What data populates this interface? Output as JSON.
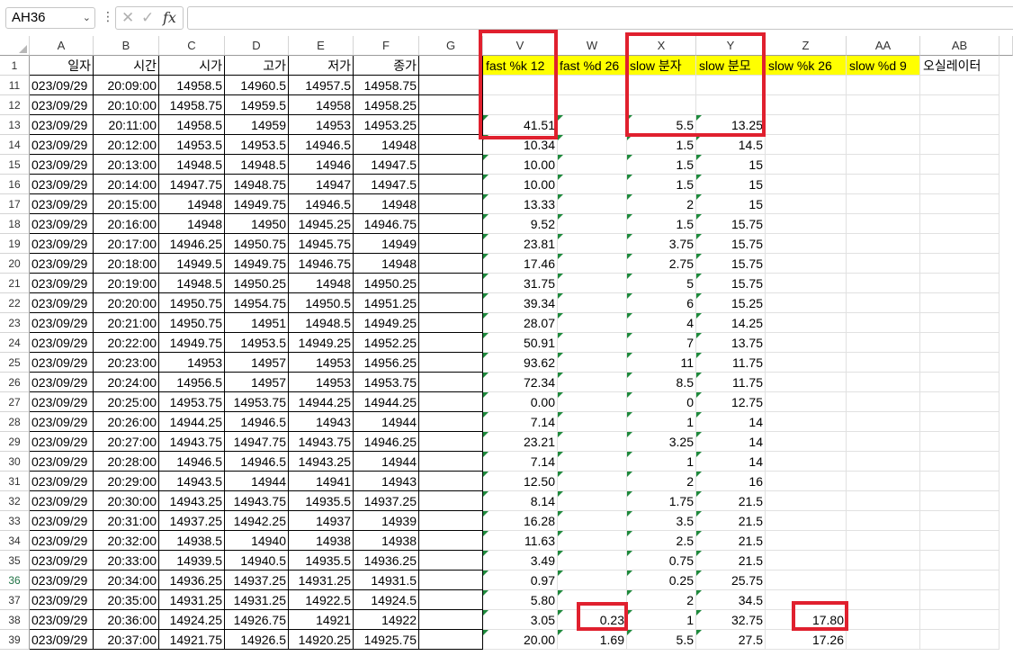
{
  "formula_bar": {
    "name_box": "AH36",
    "formula": ""
  },
  "icons": {
    "cancel": "x-icon",
    "enter": "check-icon",
    "function": "fx-icon"
  },
  "columns": [
    "A",
    "B",
    "C",
    "D",
    "E",
    "F",
    "G",
    "V",
    "W",
    "X",
    "Y",
    "Z",
    "AA",
    "AB"
  ],
  "header_row": {
    "row": "1",
    "A": "일자",
    "B": "시간",
    "C": "시가",
    "D": "고가",
    "E": "저가",
    "F": "종가",
    "G": "",
    "V": "fast %k 12",
    "W": "fast %d 26",
    "X": "slow 분자",
    "Y": "slow 분모",
    "Z": "slow %k 26",
    "AA": "slow %d 9",
    "AB": "오실레이터"
  },
  "rows": [
    {
      "row": "11",
      "A": "023/09/29",
      "B": "20:09:00",
      "C": "14958.5",
      "D": "14960.5",
      "E": "14957.5",
      "F": "14958.75",
      "V": "",
      "W": "",
      "X": "",
      "Y": "",
      "Z": ""
    },
    {
      "row": "12",
      "A": "023/09/29",
      "B": "20:10:00",
      "C": "14958.75",
      "D": "14959.5",
      "E": "14958",
      "F": "14958.25",
      "V": "",
      "W": "",
      "X": "",
      "Y": "",
      "Z": ""
    },
    {
      "row": "13",
      "A": "023/09/29",
      "B": "20:11:00",
      "C": "14958.5",
      "D": "14959",
      "E": "14953",
      "F": "14953.25",
      "V": "41.51",
      "W": "",
      "X": "5.5",
      "Y": "13.25",
      "Z": ""
    },
    {
      "row": "14",
      "A": "023/09/29",
      "B": "20:12:00",
      "C": "14953.5",
      "D": "14953.5",
      "E": "14946.5",
      "F": "14948",
      "V": "10.34",
      "W": "",
      "X": "1.5",
      "Y": "14.5",
      "Z": ""
    },
    {
      "row": "15",
      "A": "023/09/29",
      "B": "20:13:00",
      "C": "14948.5",
      "D": "14948.5",
      "E": "14946",
      "F": "14947.5",
      "V": "10.00",
      "W": "",
      "X": "1.5",
      "Y": "15",
      "Z": ""
    },
    {
      "row": "16",
      "A": "023/09/29",
      "B": "20:14:00",
      "C": "14947.75",
      "D": "14948.75",
      "E": "14947",
      "F": "14947.5",
      "V": "10.00",
      "W": "",
      "X": "1.5",
      "Y": "15",
      "Z": ""
    },
    {
      "row": "17",
      "A": "023/09/29",
      "B": "20:15:00",
      "C": "14948",
      "D": "14949.75",
      "E": "14946.5",
      "F": "14948",
      "V": "13.33",
      "W": "",
      "X": "2",
      "Y": "15",
      "Z": ""
    },
    {
      "row": "18",
      "A": "023/09/29",
      "B": "20:16:00",
      "C": "14948",
      "D": "14950",
      "E": "14945.25",
      "F": "14946.75",
      "V": "9.52",
      "W": "",
      "X": "1.5",
      "Y": "15.75",
      "Z": ""
    },
    {
      "row": "19",
      "A": "023/09/29",
      "B": "20:17:00",
      "C": "14946.25",
      "D": "14950.75",
      "E": "14945.75",
      "F": "14949",
      "V": "23.81",
      "W": "",
      "X": "3.75",
      "Y": "15.75",
      "Z": ""
    },
    {
      "row": "20",
      "A": "023/09/29",
      "B": "20:18:00",
      "C": "14949.5",
      "D": "14949.75",
      "E": "14946.75",
      "F": "14948",
      "V": "17.46",
      "W": "",
      "X": "2.75",
      "Y": "15.75",
      "Z": ""
    },
    {
      "row": "21",
      "A": "023/09/29",
      "B": "20:19:00",
      "C": "14948.5",
      "D": "14950.25",
      "E": "14948",
      "F": "14950.25",
      "V": "31.75",
      "W": "",
      "X": "5",
      "Y": "15.75",
      "Z": ""
    },
    {
      "row": "22",
      "A": "023/09/29",
      "B": "20:20:00",
      "C": "14950.75",
      "D": "14954.75",
      "E": "14950.5",
      "F": "14951.25",
      "V": "39.34",
      "W": "",
      "X": "6",
      "Y": "15.25",
      "Z": ""
    },
    {
      "row": "23",
      "A": "023/09/29",
      "B": "20:21:00",
      "C": "14950.75",
      "D": "14951",
      "E": "14948.5",
      "F": "14949.25",
      "V": "28.07",
      "W": "",
      "X": "4",
      "Y": "14.25",
      "Z": ""
    },
    {
      "row": "24",
      "A": "023/09/29",
      "B": "20:22:00",
      "C": "14949.75",
      "D": "14953.5",
      "E": "14949.25",
      "F": "14952.25",
      "V": "50.91",
      "W": "",
      "X": "7",
      "Y": "13.75",
      "Z": ""
    },
    {
      "row": "25",
      "A": "023/09/29",
      "B": "20:23:00",
      "C": "14953",
      "D": "14957",
      "E": "14953",
      "F": "14956.25",
      "V": "93.62",
      "W": "",
      "X": "11",
      "Y": "11.75",
      "Z": ""
    },
    {
      "row": "26",
      "A": "023/09/29",
      "B": "20:24:00",
      "C": "14956.5",
      "D": "14957",
      "E": "14953",
      "F": "14953.75",
      "V": "72.34",
      "W": "",
      "X": "8.5",
      "Y": "11.75",
      "Z": ""
    },
    {
      "row": "27",
      "A": "023/09/29",
      "B": "20:25:00",
      "C": "14953.75",
      "D": "14953.75",
      "E": "14944.25",
      "F": "14944.25",
      "V": "0.00",
      "W": "",
      "X": "0",
      "Y": "12.75",
      "Z": ""
    },
    {
      "row": "28",
      "A": "023/09/29",
      "B": "20:26:00",
      "C": "14944.25",
      "D": "14946.5",
      "E": "14943",
      "F": "14944",
      "V": "7.14",
      "W": "",
      "X": "1",
      "Y": "14",
      "Z": ""
    },
    {
      "row": "29",
      "A": "023/09/29",
      "B": "20:27:00",
      "C": "14943.75",
      "D": "14947.75",
      "E": "14943.75",
      "F": "14946.25",
      "V": "23.21",
      "W": "",
      "X": "3.25",
      "Y": "14",
      "Z": ""
    },
    {
      "row": "30",
      "A": "023/09/29",
      "B": "20:28:00",
      "C": "14946.5",
      "D": "14946.5",
      "E": "14943.25",
      "F": "14944",
      "V": "7.14",
      "W": "",
      "X": "1",
      "Y": "14",
      "Z": ""
    },
    {
      "row": "31",
      "A": "023/09/29",
      "B": "20:29:00",
      "C": "14943.5",
      "D": "14944",
      "E": "14941",
      "F": "14943",
      "V": "12.50",
      "W": "",
      "X": "2",
      "Y": "16",
      "Z": ""
    },
    {
      "row": "32",
      "A": "023/09/29",
      "B": "20:30:00",
      "C": "14943.25",
      "D": "14943.75",
      "E": "14935.5",
      "F": "14937.25",
      "V": "8.14",
      "W": "",
      "X": "1.75",
      "Y": "21.5",
      "Z": ""
    },
    {
      "row": "33",
      "A": "023/09/29",
      "B": "20:31:00",
      "C": "14937.25",
      "D": "14942.25",
      "E": "14937",
      "F": "14939",
      "V": "16.28",
      "W": "",
      "X": "3.5",
      "Y": "21.5",
      "Z": ""
    },
    {
      "row": "34",
      "A": "023/09/29",
      "B": "20:32:00",
      "C": "14938.5",
      "D": "14940",
      "E": "14938",
      "F": "14938",
      "V": "11.63",
      "W": "",
      "X": "2.5",
      "Y": "21.5",
      "Z": ""
    },
    {
      "row": "35",
      "A": "023/09/29",
      "B": "20:33:00",
      "C": "14939.5",
      "D": "14940.5",
      "E": "14935.5",
      "F": "14936.25",
      "V": "3.49",
      "W": "",
      "X": "0.75",
      "Y": "21.5",
      "Z": ""
    },
    {
      "row": "36",
      "A": "023/09/29",
      "B": "20:34:00",
      "C": "14936.25",
      "D": "14937.25",
      "E": "14931.25",
      "F": "14931.5",
      "V": "0.97",
      "W": "",
      "X": "0.25",
      "Y": "25.75",
      "Z": ""
    },
    {
      "row": "37",
      "A": "023/09/29",
      "B": "20:35:00",
      "C": "14931.25",
      "D": "14931.25",
      "E": "14922.5",
      "F": "14924.5",
      "V": "5.80",
      "W": "",
      "X": "2",
      "Y": "34.5",
      "Z": ""
    },
    {
      "row": "38",
      "A": "023/09/29",
      "B": "20:36:00",
      "C": "14924.25",
      "D": "14926.75",
      "E": "14921",
      "F": "14922",
      "V": "3.05",
      "W": "0.23",
      "X": "1",
      "Y": "32.75",
      "Z": "17.80"
    },
    {
      "row": "39",
      "A": "023/09/29",
      "B": "20:37:00",
      "C": "14921.75",
      "D": "14926.5",
      "E": "14920.25",
      "F": "14925.75",
      "V": "20.00",
      "W": "1.69",
      "X": "5.5",
      "Y": "27.5",
      "Z": "17.26"
    }
  ]
}
